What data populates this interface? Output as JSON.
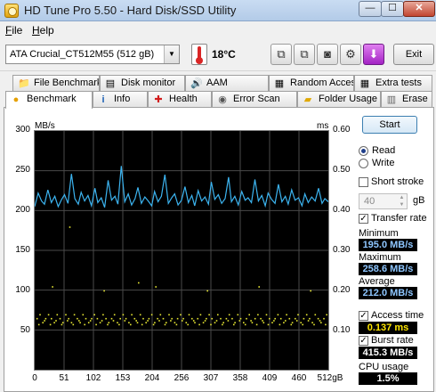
{
  "window": {
    "title": "HD Tune Pro 5.50 - Hard Disk/SSD Utility",
    "min_glyph": "—",
    "max_glyph": "☐",
    "close_glyph": "✕"
  },
  "menu": {
    "file": "File",
    "help": "Help"
  },
  "toolbar": {
    "drive": "ATA    Crucial_CT512M55 (512 gB)",
    "temperature": "18°C",
    "exit_label": "Exit",
    "button_glyphs": [
      "⧉",
      "⧉",
      "◙",
      "⚙",
      "⬇"
    ]
  },
  "tabs": {
    "row1": [
      {
        "label": "File Benchmark",
        "icon": "📁"
      },
      {
        "label": "Disk monitor",
        "icon": "▤"
      },
      {
        "label": "AAM",
        "icon": "🔊"
      },
      {
        "label": "Random Access",
        "icon": "▦"
      },
      {
        "label": "Extra tests",
        "icon": "▦"
      }
    ],
    "row2": [
      {
        "label": "Benchmark",
        "icon": "●"
      },
      {
        "label": "Info",
        "icon": "i"
      },
      {
        "label": "Health",
        "icon": "✚"
      },
      {
        "label": "Error Scan",
        "icon": "◉"
      },
      {
        "label": "Folder Usage",
        "icon": "▰"
      },
      {
        "label": "Erase",
        "icon": "▥"
      }
    ]
  },
  "controls": {
    "start": "Start",
    "read": "Read",
    "write": "Write",
    "mode_selected": "Read",
    "short_stroke": "Short stroke",
    "short_stroke_checked": false,
    "short_stroke_value": "40",
    "short_stroke_unit": "gB",
    "transfer_rate": "Transfer rate",
    "transfer_rate_checked": true,
    "access_time": "Access time",
    "access_time_checked": true,
    "burst_rate": "Burst rate",
    "burst_rate_checked": true
  },
  "stats": {
    "minimum_label": "Minimum",
    "minimum": "195.0 MB/s",
    "maximum_label": "Maximum",
    "maximum": "258.6 MB/s",
    "average_label": "Average",
    "average": "212.0 MB/s",
    "access_time": "0.137 ms",
    "burst_rate": "415.3 MB/s",
    "cpu_label": "CPU usage",
    "cpu": "1.5%"
  },
  "chart_data": {
    "type": "line",
    "left_unit": "MB/s",
    "right_unit": "ms",
    "y_left_ticks": [
      "300",
      "250",
      "200",
      "150",
      "100",
      "50"
    ],
    "y_right_ticks": [
      "0.60",
      "0.50",
      "0.40",
      "0.30",
      "0.20",
      "0.10"
    ],
    "x_ticks": [
      "0",
      "51",
      "102",
      "153",
      "204",
      "256",
      "307",
      "358",
      "409",
      "460",
      "512gB"
    ],
    "xlim": [
      0,
      512
    ],
    "ylim_left": [
      0,
      300
    ],
    "ylim_right": [
      0,
      0.6
    ],
    "grid": true,
    "colors": {
      "background": "#000000",
      "grid": "#4a4a4a",
      "transfer": "#3cb4f0",
      "access": "#e6e632"
    },
    "series": [
      {
        "name": "Transfer rate",
        "axis": "left",
        "x": [
          0,
          6,
          12,
          17,
          23,
          29,
          35,
          41,
          47,
          52,
          58,
          64,
          70,
          76,
          81,
          87,
          93,
          99,
          105,
          110,
          116,
          122,
          128,
          134,
          140,
          145,
          151,
          157,
          163,
          169,
          175,
          180,
          186,
          192,
          198,
          204,
          209,
          215,
          221,
          227,
          233,
          239,
          244,
          250,
          256,
          262,
          268,
          274,
          279,
          285,
          291,
          297,
          303,
          308,
          314,
          320,
          326,
          332,
          338,
          343,
          349,
          355,
          361,
          367,
          372,
          378,
          384,
          390,
          396,
          402,
          407,
          413,
          419,
          425,
          431,
          437,
          442,
          448,
          454,
          460,
          466,
          471,
          477,
          483,
          489,
          495,
          501,
          506,
          512
        ],
        "values": [
          205,
          222,
          212,
          208,
          226,
          210,
          218,
          205,
          214,
          220,
          209,
          246,
          215,
          208,
          223,
          212,
          219,
          206,
          228,
          210,
          216,
          204,
          238,
          213,
          218,
          208,
          256,
          211,
          221,
          207,
          215,
          229,
          209,
          217,
          212,
          206,
          224,
          211,
          218,
          245,
          209,
          216,
          221,
          207,
          213,
          230,
          210,
          219,
          206,
          225,
          212,
          217,
          208,
          236,
          214,
          220,
          209,
          215,
          242,
          211,
          218,
          207,
          224,
          213,
          216,
          210,
          239,
          212,
          219,
          206,
          222,
          214,
          209,
          233,
          211,
          218,
          208,
          226,
          213,
          216,
          206,
          221,
          210,
          217,
          212,
          228,
          209,
          215,
          211
        ]
      },
      {
        "name": "Access time",
        "axis": "right",
        "x": [
          3,
          8,
          13,
          18,
          23,
          28,
          33,
          38,
          43,
          48,
          53,
          58,
          63,
          68,
          73,
          78,
          83,
          88,
          93,
          98,
          103,
          108,
          113,
          118,
          123,
          128,
          133,
          138,
          143,
          148,
          153,
          158,
          163,
          168,
          173,
          178,
          183,
          188,
          193,
          198,
          203,
          208,
          213,
          218,
          223,
          228,
          233,
          238,
          243,
          248,
          253,
          258,
          263,
          268,
          273,
          278,
          283,
          288,
          293,
          298,
          303,
          308,
          313,
          318,
          323,
          328,
          333,
          338,
          343,
          348,
          353,
          358,
          363,
          368,
          373,
          378,
          383,
          388,
          393,
          398,
          403,
          408,
          413,
          418,
          423,
          428,
          433,
          438,
          443,
          448,
          453,
          458,
          463,
          468,
          473,
          478,
          483,
          488,
          493,
          498,
          503,
          508,
          6,
          16,
          26,
          36,
          46,
          56,
          66,
          76,
          86,
          96,
          106,
          116,
          126,
          136,
          146,
          156,
          166,
          176,
          186,
          196,
          206,
          216,
          226,
          236,
          246,
          256,
          266,
          276,
          286,
          296,
          306,
          316,
          326,
          336,
          346,
          356,
          366,
          376,
          386,
          396,
          406,
          416,
          426,
          436,
          446,
          456,
          466,
          476,
          486,
          496,
          506,
          30,
          120,
          210,
          300,
          390,
          480,
          60,
          180
        ],
        "values": [
          0.13,
          0.14,
          0.12,
          0.13,
          0.14,
          0.13,
          0.12,
          0.14,
          0.13,
          0.12,
          0.14,
          0.13,
          0.12,
          0.14,
          0.13,
          0.12,
          0.14,
          0.13,
          0.12,
          0.13,
          0.14,
          0.13,
          0.12,
          0.14,
          0.13,
          0.12,
          0.13,
          0.14,
          0.12,
          0.13,
          0.14,
          0.13,
          0.12,
          0.14,
          0.13,
          0.12,
          0.14,
          0.13,
          0.12,
          0.13,
          0.14,
          0.12,
          0.13,
          0.14,
          0.13,
          0.12,
          0.14,
          0.13,
          0.12,
          0.13,
          0.14,
          0.13,
          0.12,
          0.14,
          0.13,
          0.12,
          0.13,
          0.14,
          0.12,
          0.13,
          0.14,
          0.13,
          0.12,
          0.14,
          0.13,
          0.12,
          0.13,
          0.14,
          0.13,
          0.12,
          0.14,
          0.13,
          0.12,
          0.13,
          0.14,
          0.12,
          0.13,
          0.14,
          0.13,
          0.12,
          0.14,
          0.13,
          0.12,
          0.13,
          0.14,
          0.13,
          0.12,
          0.14,
          0.13,
          0.12,
          0.13,
          0.14,
          0.12,
          0.13,
          0.14,
          0.13,
          0.12,
          0.14,
          0.13,
          0.12,
          0.13,
          0.14,
          0.115,
          0.125,
          0.115,
          0.125,
          0.115,
          0.125,
          0.115,
          0.125,
          0.115,
          0.125,
          0.115,
          0.125,
          0.115,
          0.125,
          0.115,
          0.125,
          0.115,
          0.125,
          0.115,
          0.125,
          0.115,
          0.125,
          0.115,
          0.125,
          0.115,
          0.125,
          0.115,
          0.125,
          0.115,
          0.125,
          0.115,
          0.125,
          0.115,
          0.125,
          0.115,
          0.125,
          0.115,
          0.125,
          0.115,
          0.125,
          0.115,
          0.125,
          0.115,
          0.125,
          0.115,
          0.125,
          0.115,
          0.125,
          0.115,
          0.125,
          0.115,
          0.21,
          0.2,
          0.21,
          0.2,
          0.21,
          0.2,
          0.36,
          0.22
        ]
      }
    ]
  }
}
